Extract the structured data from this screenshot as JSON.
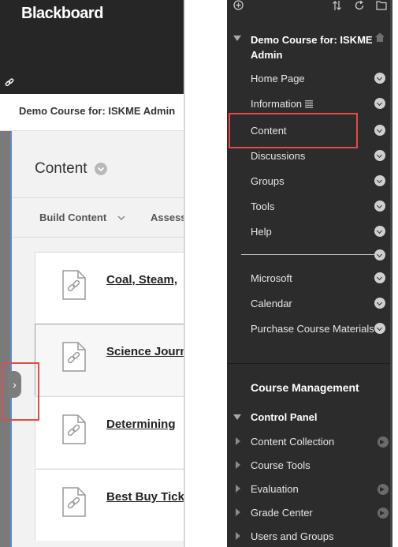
{
  "app": {
    "brand": "Blackboard",
    "course_title": "Demo Course for: ISKME Admin"
  },
  "content_page": {
    "heading": "Content",
    "toolbar": {
      "build_content": "Build Content",
      "assess": "Assess"
    },
    "items": [
      {
        "title": "Coal, Steam,"
      },
      {
        "title": "Science Journ"
      },
      {
        "title": "Determining"
      },
      {
        "title": "Best Buy Tick"
      }
    ]
  },
  "course_menu": {
    "course_name": "Demo Course for: ISKME Admin",
    "items": [
      {
        "label": "Home Page"
      },
      {
        "label": "Information"
      },
      {
        "label": "Content"
      },
      {
        "label": "Discussions"
      },
      {
        "label": "Groups"
      },
      {
        "label": "Tools"
      },
      {
        "label": "Help"
      },
      {
        "label": "Microsoft"
      },
      {
        "label": "Calendar"
      },
      {
        "label": "Purchase Course Materials"
      }
    ]
  },
  "course_management": {
    "heading": "Course Management",
    "control_panel": "Control Panel",
    "items": [
      {
        "label": "Content Collection"
      },
      {
        "label": "Course Tools"
      },
      {
        "label": "Evaluation"
      },
      {
        "label": "Grade Center"
      },
      {
        "label": "Users and Groups"
      }
    ]
  },
  "colors": {
    "header_dark": "#262626",
    "menu_dark": "#2c2c2c",
    "highlight_red": "#e34a4a",
    "link_blue": "#5b8fcf"
  },
  "icons": [
    "link-icon",
    "chevron-down-icon",
    "document-link-icon",
    "chevron-right-icon",
    "add-icon",
    "sort-icon",
    "refresh-icon",
    "folder-icon",
    "home-icon",
    "arrow-right-icon"
  ]
}
